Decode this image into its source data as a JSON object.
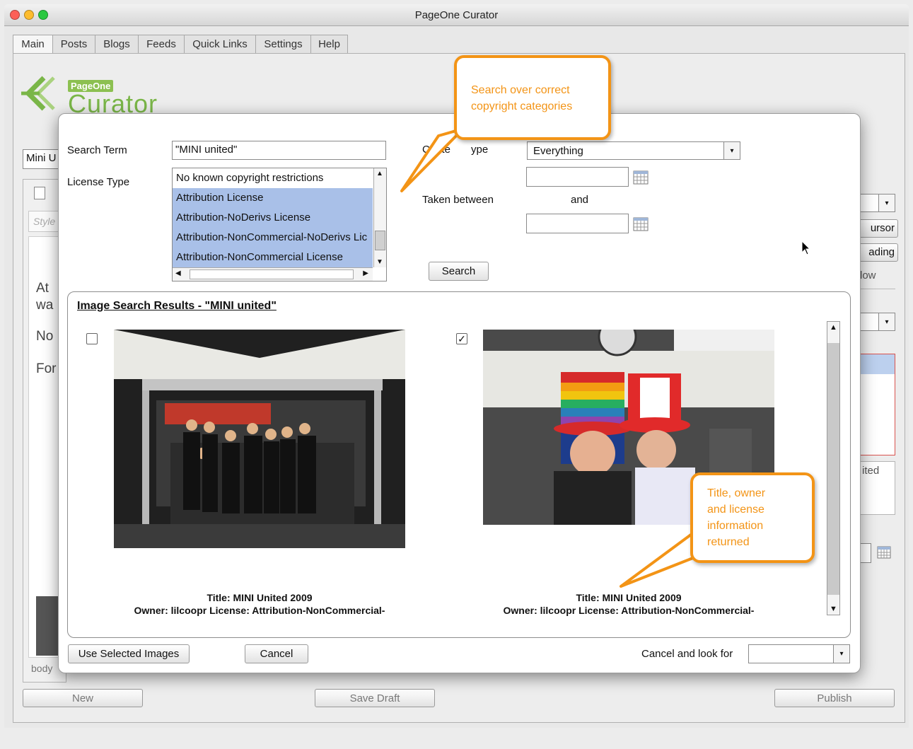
{
  "window": {
    "title": "PageOne Curator"
  },
  "tabs": [
    "Main",
    "Posts",
    "Blogs",
    "Feeds",
    "Quick Links",
    "Settings",
    "Help"
  ],
  "logo": {
    "small": "PageOne",
    "big": "Curator"
  },
  "background": {
    "title_field": "Mini U",
    "style_placeholder": "Style",
    "editor_lines": [
      "At",
      "wa",
      "No",
      "For"
    ],
    "body_label": "body",
    "right_buttons": [
      "ursor",
      "ading"
    ],
    "right_text": "low",
    "right_box_text": "ited",
    "bottom_buttons": {
      "new": "New",
      "save_draft": "Save Draft",
      "publish": "Publish"
    }
  },
  "dialog": {
    "search_term_label": "Search Term",
    "search_term_value": "\"MINI united\"",
    "license_type_label": "License Type",
    "licenses": [
      {
        "label": "No known copyright restrictions",
        "selected": false
      },
      {
        "label": "Attribution License",
        "selected": true
      },
      {
        "label": "Attribution-NoDerivs License",
        "selected": true
      },
      {
        "label": "Attribution-NonCommercial-NoDerivs Lic",
        "selected": true
      },
      {
        "label": "Attribution-NonCommercial License",
        "selected": true
      }
    ],
    "content_type_label_a": "Conte",
    "content_type_label_b": "ype",
    "content_type_value": "Everything",
    "taken_between_label": "Taken between",
    "and_label": "and",
    "search_button": "Search",
    "results": {
      "heading": "Image Search Results - \"MINI united\"",
      "items": [
        {
          "checked": false,
          "title": "Title: MINI United 2009",
          "owner_license": "Owner: lilcoopr License: Attribution-NonCommercial-"
        },
        {
          "checked": true,
          "title": "Title: MINI United 2009",
          "owner_license": "Owner: lilcoopr License: Attribution-NonCommercial-"
        }
      ]
    },
    "use_selected_button": "Use Selected Images",
    "cancel_button": "Cancel",
    "cancel_look_label": "Cancel and look for",
    "cancel_look_value": ""
  },
  "callouts": {
    "search": [
      "Search over correct",
      "copyright categories"
    ],
    "title": [
      "Title, owner",
      "and license",
      "information",
      "returned"
    ]
  },
  "colors": {
    "callout": "#f39416",
    "selection": "#a9c0e8",
    "logo_green": "#7ab648"
  }
}
